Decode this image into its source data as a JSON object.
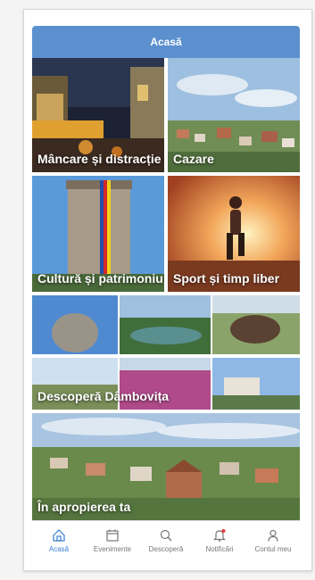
{
  "header": {
    "title": "Acasă"
  },
  "tiles": [
    {
      "label": "Mâncare și distracție"
    },
    {
      "label": "Cazare"
    },
    {
      "label": "Cultură și patrimoniu"
    },
    {
      "label": "Sport și timp liber"
    },
    {
      "label": "Descoperă Dâmbovița"
    },
    {
      "label": "În apropierea ta"
    }
  ],
  "tabs": [
    {
      "label": "Acasă",
      "icon": "home-icon"
    },
    {
      "label": "Evenimente",
      "icon": "calendar-icon"
    },
    {
      "label": "Descoperă",
      "icon": "search-icon"
    },
    {
      "label": "Notificări",
      "icon": "bell-icon"
    },
    {
      "label": "Contul meu",
      "icon": "user-icon"
    }
  ],
  "colors": {
    "accent": "#5b8fce",
    "active_tab": "#3a7fd0",
    "notification_dot": "#e53935"
  }
}
